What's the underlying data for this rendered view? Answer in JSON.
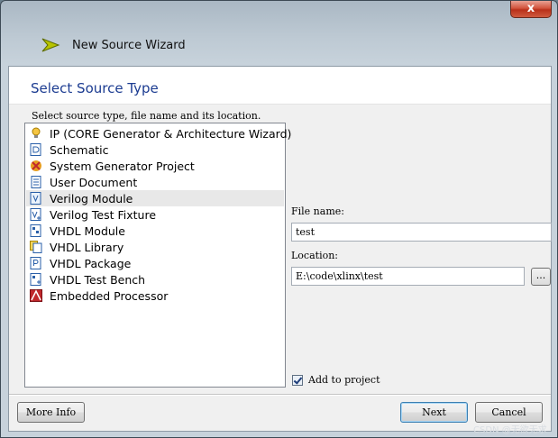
{
  "window": {
    "title": "New Source Wizard",
    "close_glyph": "x"
  },
  "header": {
    "title": "Select Source Type"
  },
  "instruction": "Select source type, file name and its location.",
  "source_types": [
    {
      "label": "IP (CORE Generator & Architecture Wizard)",
      "icon": "lightbulb-icon",
      "selected": false
    },
    {
      "label": "Schematic",
      "icon": "schematic-icon",
      "selected": false
    },
    {
      "label": "System Generator Project",
      "icon": "sysgen-icon",
      "selected": false
    },
    {
      "label": "User Document",
      "icon": "document-icon",
      "selected": false
    },
    {
      "label": "Verilog Module",
      "icon": "verilog-module-icon",
      "selected": true
    },
    {
      "label": "Verilog Test Fixture",
      "icon": "verilog-test-icon",
      "selected": false
    },
    {
      "label": "VHDL Module",
      "icon": "vhdl-module-icon",
      "selected": false
    },
    {
      "label": "VHDL Library",
      "icon": "vhdl-library-icon",
      "selected": false
    },
    {
      "label": "VHDL Package",
      "icon": "vhdl-package-icon",
      "selected": false
    },
    {
      "label": "VHDL Test Bench",
      "icon": "vhdl-testbench-icon",
      "selected": false
    },
    {
      "label": "Embedded Processor",
      "icon": "embedded-processor-icon",
      "selected": false
    }
  ],
  "form": {
    "file_name_label": "File name:",
    "file_name_value": "test",
    "location_label": "Location:",
    "location_value": "E:\\code\\xlinx\\test",
    "browse_label": "...",
    "add_to_project_label": "Add to project",
    "add_to_project_checked": true
  },
  "buttons": {
    "more_info": "More Info",
    "next": "Next",
    "cancel": "Cancel"
  },
  "watermark": "CSDN @无欲无求"
}
